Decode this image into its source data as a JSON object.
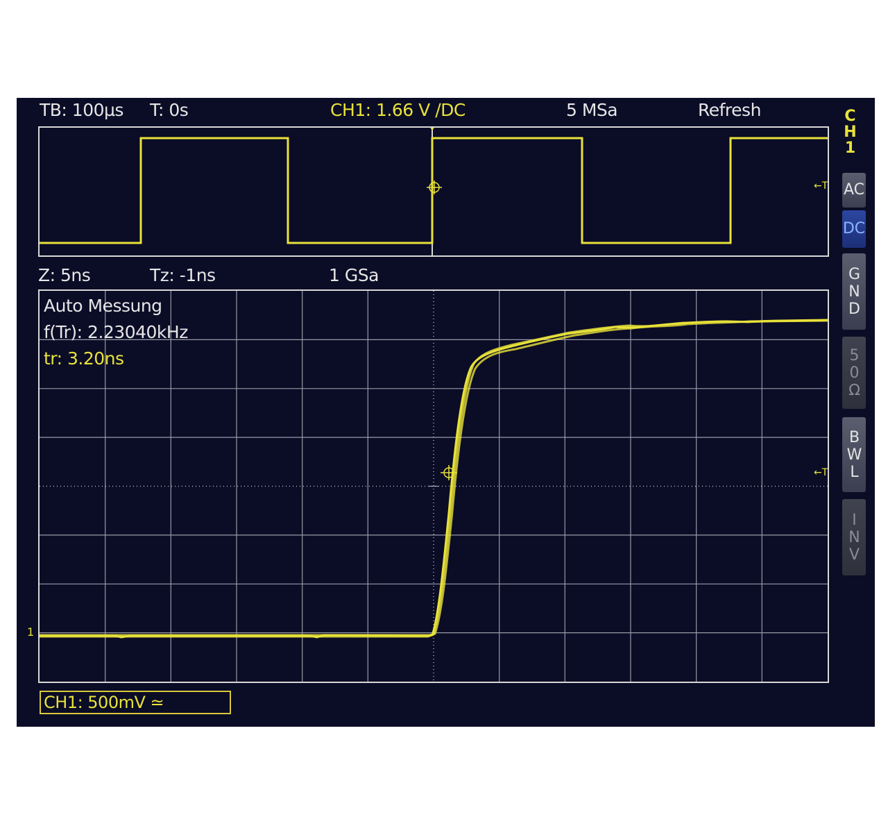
{
  "header": {
    "timebase": "TB: 100µs",
    "trigger_time": "T: 0s",
    "trigger_info": "CH1: 1.66 V ∕DC",
    "sample_rate": "5 MSa",
    "mode": "Refresh"
  },
  "zoom_header": {
    "zoom_timebase": "Z: 5ns",
    "zoom_trigger": "Tz: -1ns",
    "zoom_sample_rate": "1 GSa"
  },
  "measurements": {
    "title": "Auto Messung",
    "frequency": "f(Tr): 2.23040kHz",
    "rise_time": "tr: 3.20ns"
  },
  "channel_scale": "CH1: 500mV ≃",
  "side_menu": {
    "title": "CH1",
    "buttons": [
      {
        "label": "AC",
        "state": "normal"
      },
      {
        "label": "DC",
        "state": "active"
      },
      {
        "label": "GND",
        "state": "normal"
      },
      {
        "label": "50Ω",
        "state": "dim"
      },
      {
        "label": "BWL",
        "state": "normal"
      },
      {
        "label": "INV",
        "state": "dim"
      }
    ]
  },
  "markers": {
    "channel_ground": "1",
    "trigger_level": "←T"
  },
  "colors": {
    "screen_bg": "#0b0c26",
    "trace": "#e8e23a",
    "grid": "#c9cad3",
    "text": "#e6e6e6",
    "active_button": "#2c46a0"
  }
}
